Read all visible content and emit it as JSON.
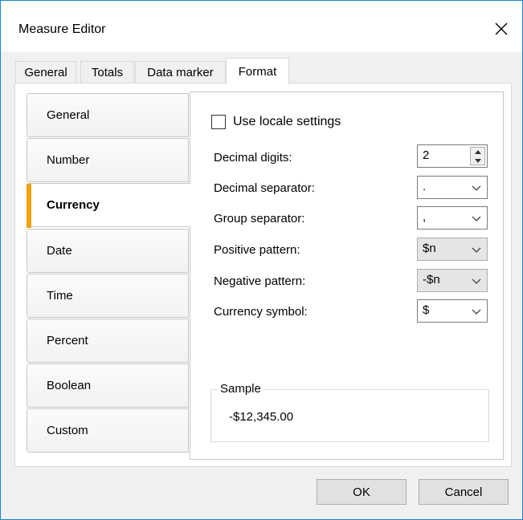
{
  "window": {
    "title": "Measure Editor"
  },
  "tabs": [
    {
      "label": "General"
    },
    {
      "label": "Totals"
    },
    {
      "label": "Data marker"
    },
    {
      "label": "Format"
    }
  ],
  "nav": [
    {
      "label": "General"
    },
    {
      "label": "Number"
    },
    {
      "label": "Currency"
    },
    {
      "label": "Date"
    },
    {
      "label": "Time"
    },
    {
      "label": "Percent"
    },
    {
      "label": "Boolean"
    },
    {
      "label": "Custom"
    }
  ],
  "form": {
    "use_locale_label": "Use locale settings",
    "use_locale_checked": false,
    "decimal_digits_label": "Decimal digits:",
    "decimal_digits_value": "2",
    "decimal_separator_label": "Decimal separator:",
    "decimal_separator_value": ".",
    "group_separator_label": "Group separator:",
    "group_separator_value": ",",
    "positive_pattern_label": "Positive pattern:",
    "positive_pattern_value": "$n",
    "negative_pattern_label": "Negative pattern:",
    "negative_pattern_value": "-$n",
    "currency_symbol_label": "Currency symbol:",
    "currency_symbol_value": "$"
  },
  "sample": {
    "label": "Sample",
    "value": "-$12,345.00"
  },
  "buttons": {
    "ok": "OK",
    "cancel": "Cancel"
  },
  "colors": {
    "accent": "#f0a30a",
    "window_border": "#1883d7"
  }
}
